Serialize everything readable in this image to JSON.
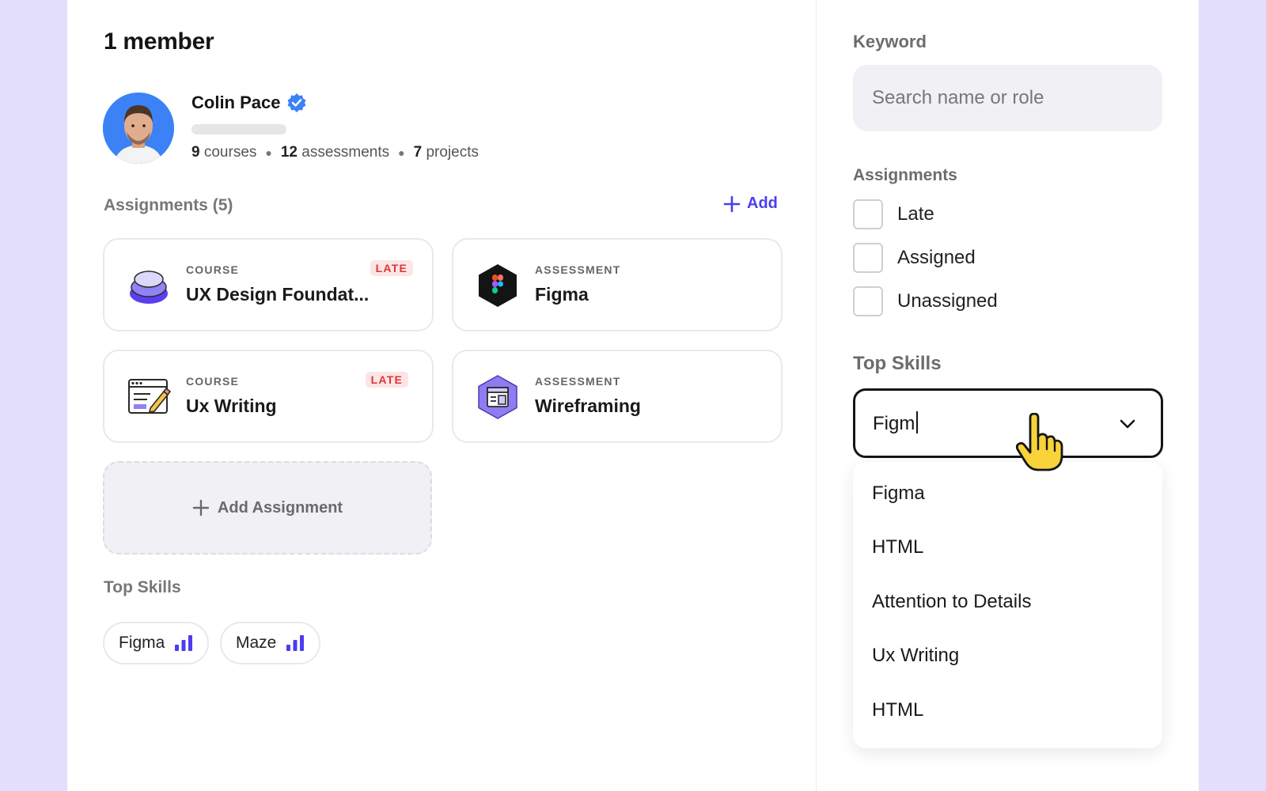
{
  "member": {
    "count_title": "1 member",
    "name": "Colin Pace",
    "stats": [
      {
        "num": "9",
        "label": "courses"
      },
      {
        "num": "12",
        "label": "assessments"
      },
      {
        "num": "7",
        "label": "projects"
      }
    ]
  },
  "assignments": {
    "title": "Assignments (5)",
    "add_label": "Add",
    "cards": [
      {
        "kind": "COURSE",
        "title": "UX Design Foundat...",
        "badge": "LATE"
      },
      {
        "kind": "ASSESSMENT",
        "title": "Figma"
      },
      {
        "kind": "COURSE",
        "title": "Ux Writing",
        "badge": "LATE"
      },
      {
        "kind": "ASSESSMENT",
        "title": "Wireframing"
      }
    ],
    "add_assignment_label": "Add Assignment"
  },
  "top_skills": {
    "title": "Top Skills",
    "pills": [
      {
        "label": "Figma"
      },
      {
        "label": "Maze"
      }
    ]
  },
  "filters": {
    "keyword_label": "Keyword",
    "search_placeholder": "Search name or role",
    "assignments_label": "Assignments",
    "options": [
      "Late",
      "Assigned",
      "Unassigned"
    ],
    "skills_label": "Top Skills",
    "skills_input_value": "Figm",
    "dropdown": [
      "Figma",
      "HTML",
      "Attention to Details",
      "Ux Writing",
      "HTML"
    ]
  },
  "colors": {
    "accent": "#4b3df0",
    "late_bg": "#fde5e5",
    "late_text": "#d93636",
    "page_bg": "#e3defc"
  }
}
